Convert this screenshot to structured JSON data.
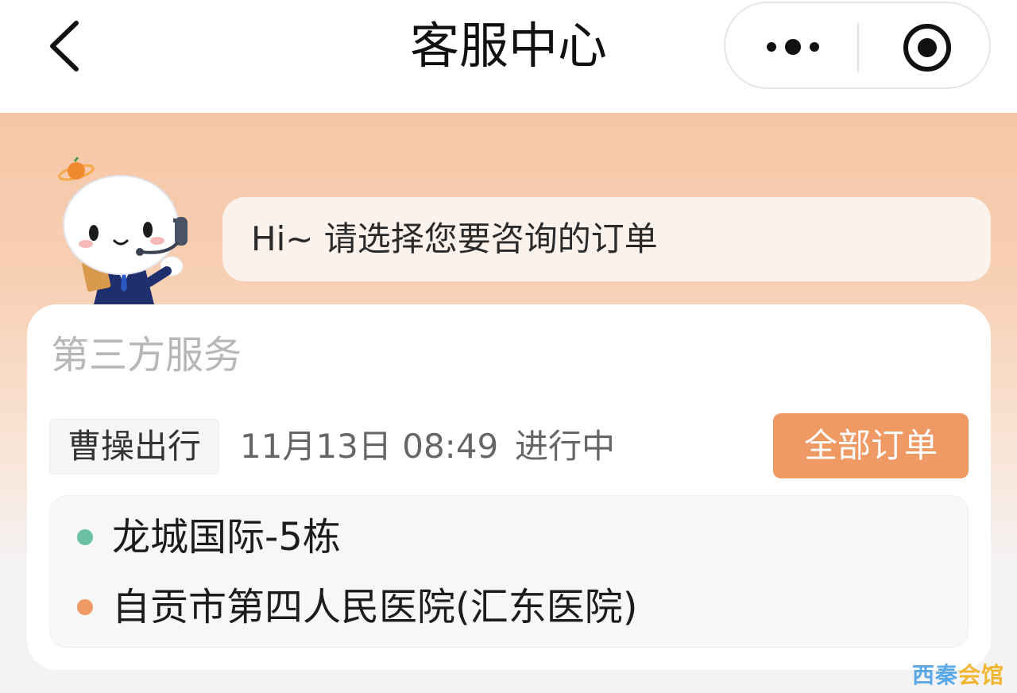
{
  "navbar": {
    "title": "客服中心",
    "back_icon": "chevron-left-icon",
    "more_icon": "more-dots-icon",
    "close_icon": "target-close-icon"
  },
  "assistant": {
    "greeting": "Hi~ 请选择您要咨询的订单"
  },
  "order_card": {
    "heading": "第三方服务",
    "provider": "曹操出行",
    "time": "11月13日 08:49",
    "status": "进行中",
    "all_orders_label": "全部订单",
    "origin": "龙城国际-5栋",
    "destination": "自贡市第四人民医院(汇东医院)"
  },
  "watermark": {
    "part1": "西秦",
    "part2": "会馆"
  },
  "colors": {
    "accent": "#ef9965",
    "origin_dot": "#6cc0a6",
    "destination_dot": "#ef9965",
    "hero_top": "#f6c6a6"
  }
}
